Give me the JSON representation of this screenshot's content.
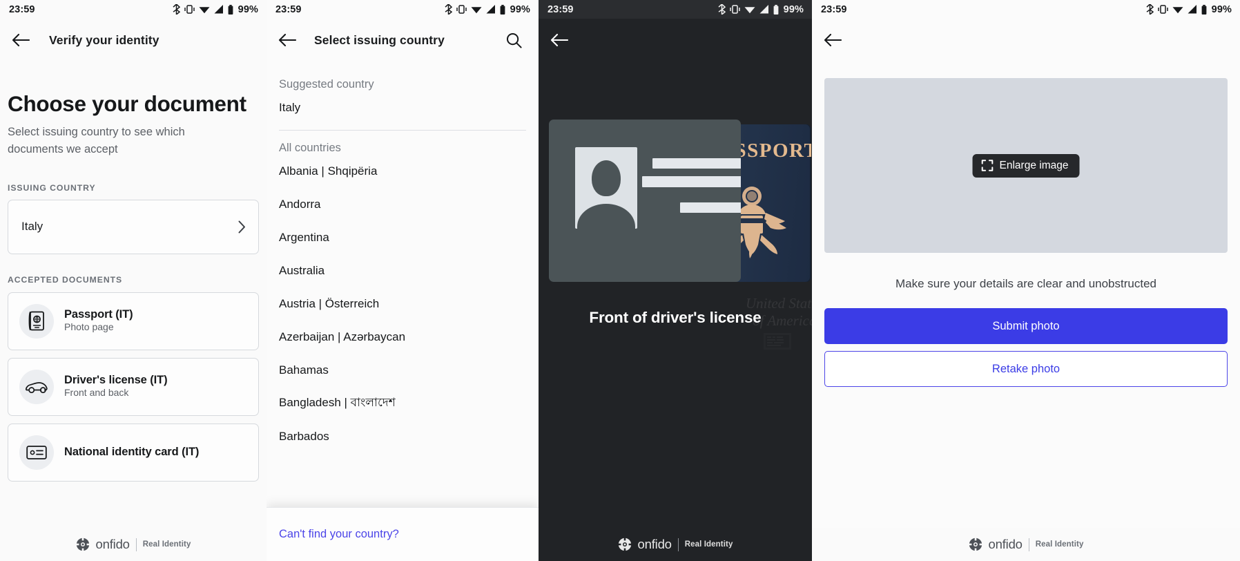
{
  "status_bar": {
    "time": "23:59",
    "battery": "99%",
    "icons": [
      "bluetooth-icon",
      "vibrate-icon",
      "wifi-icon",
      "cellular-signal-icon",
      "battery-icon"
    ]
  },
  "brand": {
    "name": "onfido",
    "product": "Real Identity"
  },
  "panel1": {
    "app_bar_title": "Verify your identity",
    "heading": "Choose your document",
    "subheading": "Select issuing country to see which documents we accept",
    "issuing_country_label": "ISSUING COUNTRY",
    "issuing_country_value": "Italy",
    "accepted_documents_label": "ACCEPTED DOCUMENTS",
    "documents": [
      {
        "title": "Passport (IT)",
        "subtitle": "Photo page",
        "icon": "passport-icon"
      },
      {
        "title": "Driver's license (IT)",
        "subtitle": "Front and back",
        "icon": "car-icon"
      },
      {
        "title": "National identity card (IT)",
        "subtitle": "",
        "icon": "id-card-icon"
      }
    ]
  },
  "panel2": {
    "app_bar_title": "Select issuing country",
    "search_icon": "search-icon",
    "suggested_label": "Suggested country",
    "suggested": [
      "Italy"
    ],
    "all_label": "All countries",
    "countries": [
      "Albania | Shqipëria",
      "Andorra",
      "Argentina",
      "Australia",
      "Austria | Österreich",
      "Azerbaijan | Azərbaycan",
      "Bahamas",
      "Bangladesh | বাংলাদেশ",
      "Barbados"
    ],
    "cant_find_link": "Can't find your country?"
  },
  "panel3": {
    "caption": "Front of driver's license",
    "passport_word": "PASSPORT",
    "passport_watermark": "United States\nof America",
    "back_icon": "back-arrow-icon"
  },
  "panel4": {
    "enlarge_label": "Enlarge image",
    "enlarge_icon": "fullscreen-icon",
    "note": "Make sure your details are clear and unobstructed",
    "submit_label": "Submit photo",
    "retake_label": "Retake photo"
  },
  "colors": {
    "accent_blue": "#3b3ce6",
    "link_blue": "#4b44e8",
    "dark_bg": "#212326",
    "passport_gold": "#e3b98e",
    "preview_grey": "#d4d8df"
  }
}
